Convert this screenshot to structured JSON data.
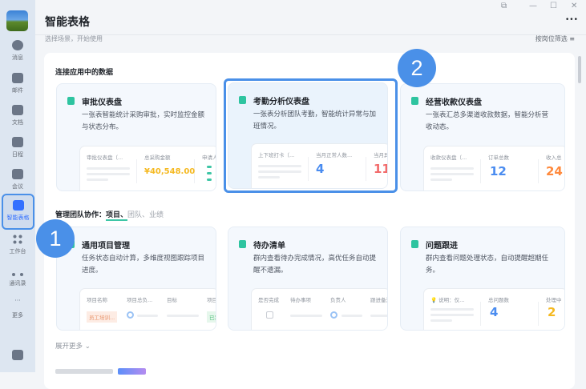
{
  "window": {
    "title": "智能表格",
    "subtitle": "选择场景，开始使用",
    "filter_label": "按岗位筛选",
    "more": "•••",
    "controls": [
      "⧉",
      "—",
      "☐",
      "✕"
    ]
  },
  "sidebar": {
    "items": [
      {
        "label": "消息"
      },
      {
        "label": "邮件"
      },
      {
        "label": "文档"
      },
      {
        "label": "日程"
      },
      {
        "label": "会议"
      },
      {
        "label": "智能表格"
      },
      {
        "label": "工作台"
      },
      {
        "label": "通讯录"
      },
      {
        "label": "更多"
      }
    ]
  },
  "section1": {
    "title": "连接应用中的数据"
  },
  "section2": {
    "title": "管理团队协作：",
    "tabs": [
      "项目、",
      "团队、",
      "业绩"
    ]
  },
  "cards1": [
    {
      "title": "审批仪表盘",
      "desc": "一张表智能统计采购审批，实时监控金额与状态分布。",
      "cols": [
        "审批仪表盘（...",
        "总采购金额",
        "申请人"
      ],
      "value": "¥40,548.00",
      "value_color": "#f5b921"
    },
    {
      "title": "考勤分析仪表盘",
      "desc": "一张表分析团队考勤，智能统计异常与加班情况。",
      "cols": [
        "上下班打卡（...",
        "当月正常人数...",
        "当月异"
      ],
      "value": "4",
      "value2": "11",
      "value_color": "#4a8cf0",
      "value2_color": "#f26b6b"
    },
    {
      "title": "经营收款仪表盘",
      "desc": "一张表汇总多渠道收款数据，智能分析营收动态。",
      "cols": [
        "收款仪表盘（...",
        "订单总数",
        "收入总"
      ],
      "value": "12",
      "value2": "24",
      "value_color": "#4a8cf0",
      "value2_color": "#ff8a3d"
    }
  ],
  "cards2": [
    {
      "title": "通用项目管理",
      "desc": "任务状态自动计算，多维度视图跟踪项目进度。",
      "cols": [
        "项目名称",
        "项目总负...",
        "目标",
        "项目"
      ],
      "tag": "员工培训...",
      "tag2": "已完"
    },
    {
      "title": "待办清单",
      "desc": "群内查看待办完成情况，高优任务自动提醒不遗漏。",
      "cols": [
        "是否完成",
        "待办事项",
        "负责人",
        "跟进备注"
      ]
    },
    {
      "title": "问题跟进",
      "desc": "群内查看问题处理状态，自动提醒超期任务。",
      "cols": [
        "💡 说明：仅...",
        "总问题数",
        "处理中"
      ],
      "value": "4",
      "value2": "2",
      "value_color": "#4a8cf0",
      "value2_color": "#f5b921"
    }
  ],
  "expand_label": "展开更多 ⌄",
  "annotations": [
    "1",
    "2"
  ]
}
